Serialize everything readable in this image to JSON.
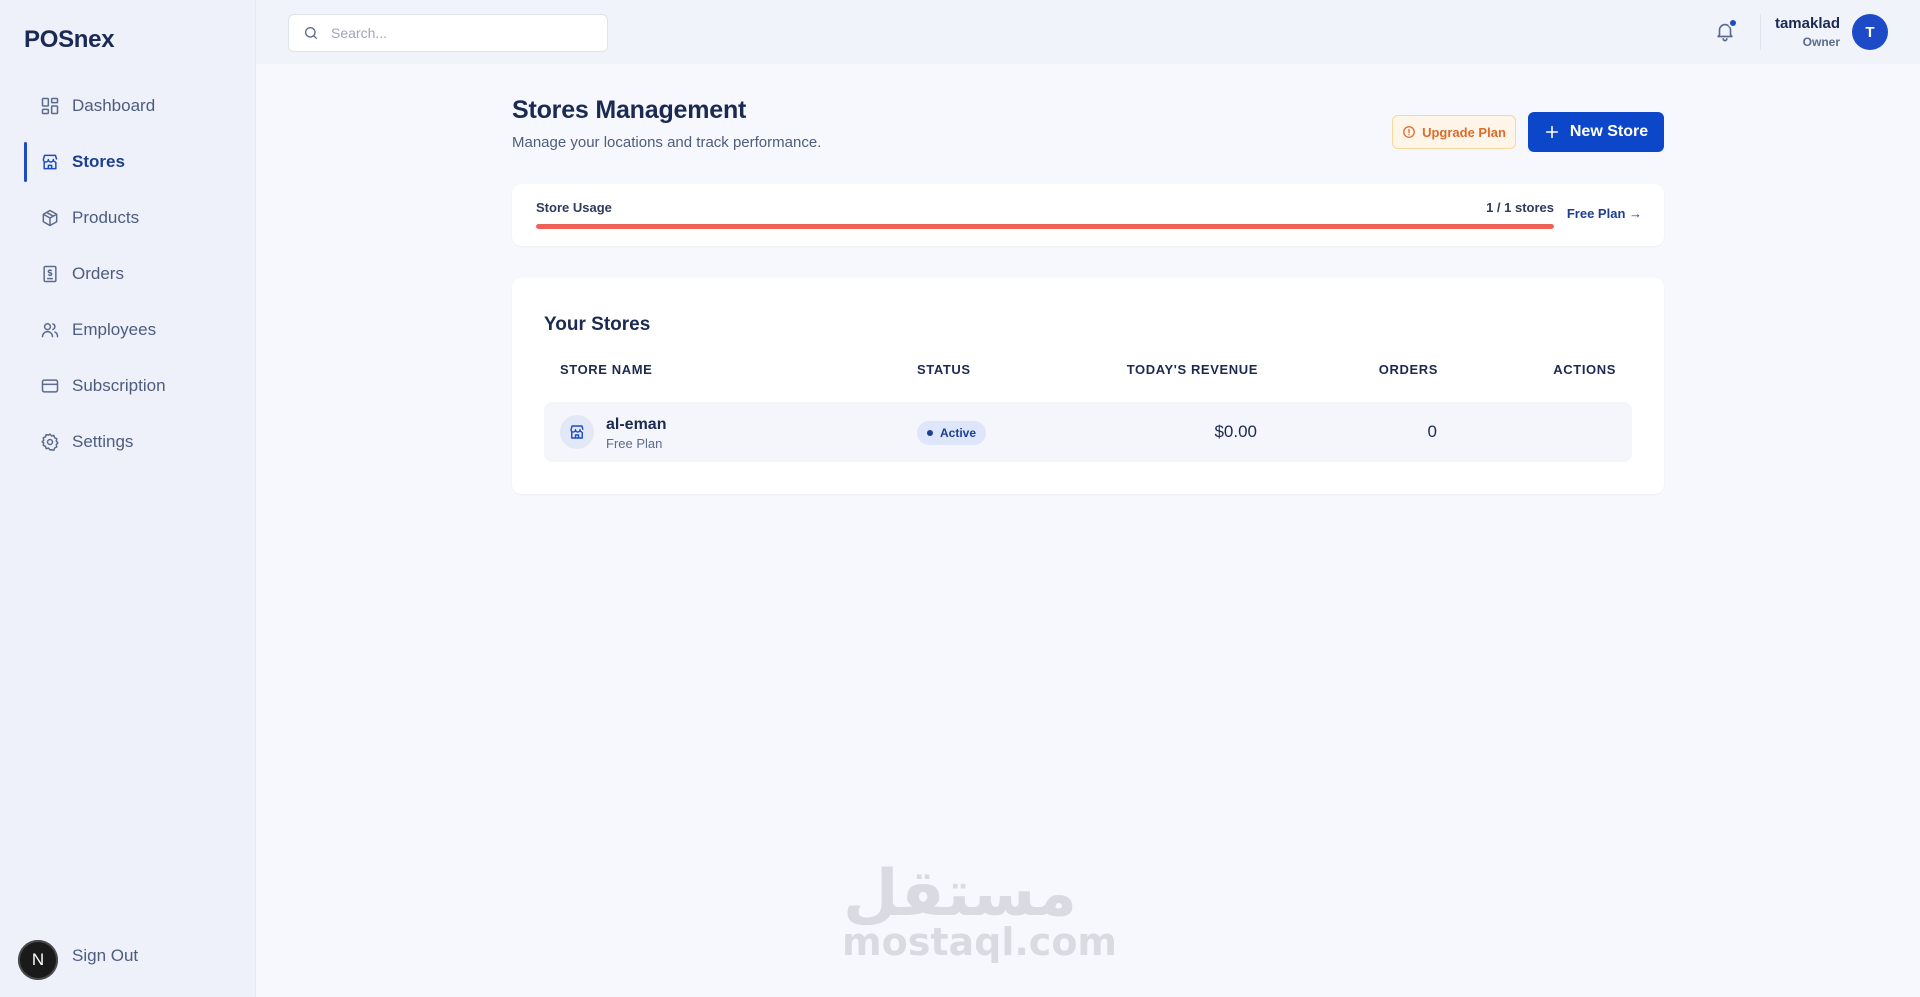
{
  "app": {
    "name": "POSnex"
  },
  "sidebar": {
    "items": [
      {
        "label": "Dashboard",
        "icon": "dashboard-icon",
        "active": false
      },
      {
        "label": "Stores",
        "icon": "store-icon",
        "active": true
      },
      {
        "label": "Products",
        "icon": "package-icon",
        "active": false
      },
      {
        "label": "Orders",
        "icon": "receipt-icon",
        "active": false
      },
      {
        "label": "Employees",
        "icon": "users-icon",
        "active": false
      },
      {
        "label": "Subscription",
        "icon": "credit-card-icon",
        "active": false
      },
      {
        "label": "Settings",
        "icon": "gear-icon",
        "active": false
      }
    ],
    "signout_label": "Sign Out",
    "dev_badge_letter": "N"
  },
  "topbar": {
    "search_placeholder": "Search...",
    "user": {
      "name": "tamaklad",
      "role": "Owner",
      "avatar_letter": "T"
    },
    "has_notification": true
  },
  "page": {
    "title": "Stores Management",
    "subtitle": "Manage your locations and track performance.",
    "upgrade_label": "Upgrade Plan",
    "new_store_label": "New Store"
  },
  "usage": {
    "label": "Store Usage",
    "count_text": "1 / 1 stores",
    "fill_fraction": 1.0,
    "plan_link": "Free Plan →"
  },
  "stores": {
    "title": "Your Stores",
    "columns": [
      "STORE NAME",
      "STATUS",
      "TODAY'S REVENUE",
      "ORDERS",
      "ACTIONS"
    ],
    "rows": [
      {
        "name": "al-eman",
        "plan": "Free Plan",
        "status": "Active",
        "revenue": "$0.00",
        "orders": "0"
      }
    ]
  },
  "watermark": {
    "arabic": "مستقل",
    "latin": "mostaql.com"
  },
  "colors": {
    "accent": "#0d47c9",
    "sidebar_bg": "#eef0fa",
    "usage_fill": "#ef6258",
    "upgrade_text": "#e06a2a"
  }
}
